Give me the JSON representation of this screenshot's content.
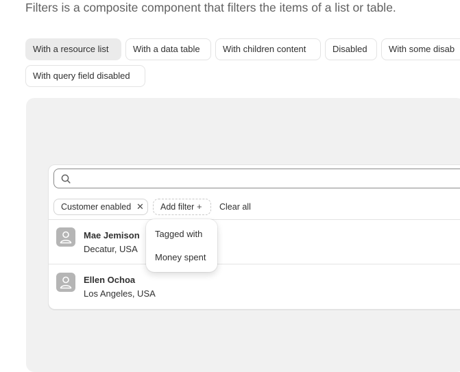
{
  "intro_text": "Filters is a composite component that filters the items of a list or table.",
  "tabs": [
    {
      "label": "With a resource list",
      "active": true
    },
    {
      "label": "With a data table",
      "active": false
    },
    {
      "label": "With children content",
      "active": false
    },
    {
      "label": "Disabled",
      "active": false
    },
    {
      "label": "With some disab",
      "active": false
    },
    {
      "label": "With query field disabled",
      "active": false
    }
  ],
  "search": {
    "value": "",
    "placeholder": ""
  },
  "applied_filters": [
    {
      "label": "Customer enabled",
      "remove_icon": "close-icon"
    }
  ],
  "add_filter": {
    "label": "Add filter",
    "icon": "plus-icon"
  },
  "clear_all_label": "Clear all",
  "items": [
    {
      "name": "Mae Jemison",
      "location": "Decatur, USA",
      "avatar_icon": "person-icon"
    },
    {
      "name": "Ellen Ochoa",
      "location": "Los Angeles, USA",
      "avatar_icon": "person-icon"
    }
  ],
  "popover_options": [
    "Tagged with",
    "Money spent"
  ],
  "colors": {
    "stage_bg": "#f1f1f1",
    "active_tab_bg": "#ebebeb",
    "avatar_bg": "#b5b5b5"
  }
}
